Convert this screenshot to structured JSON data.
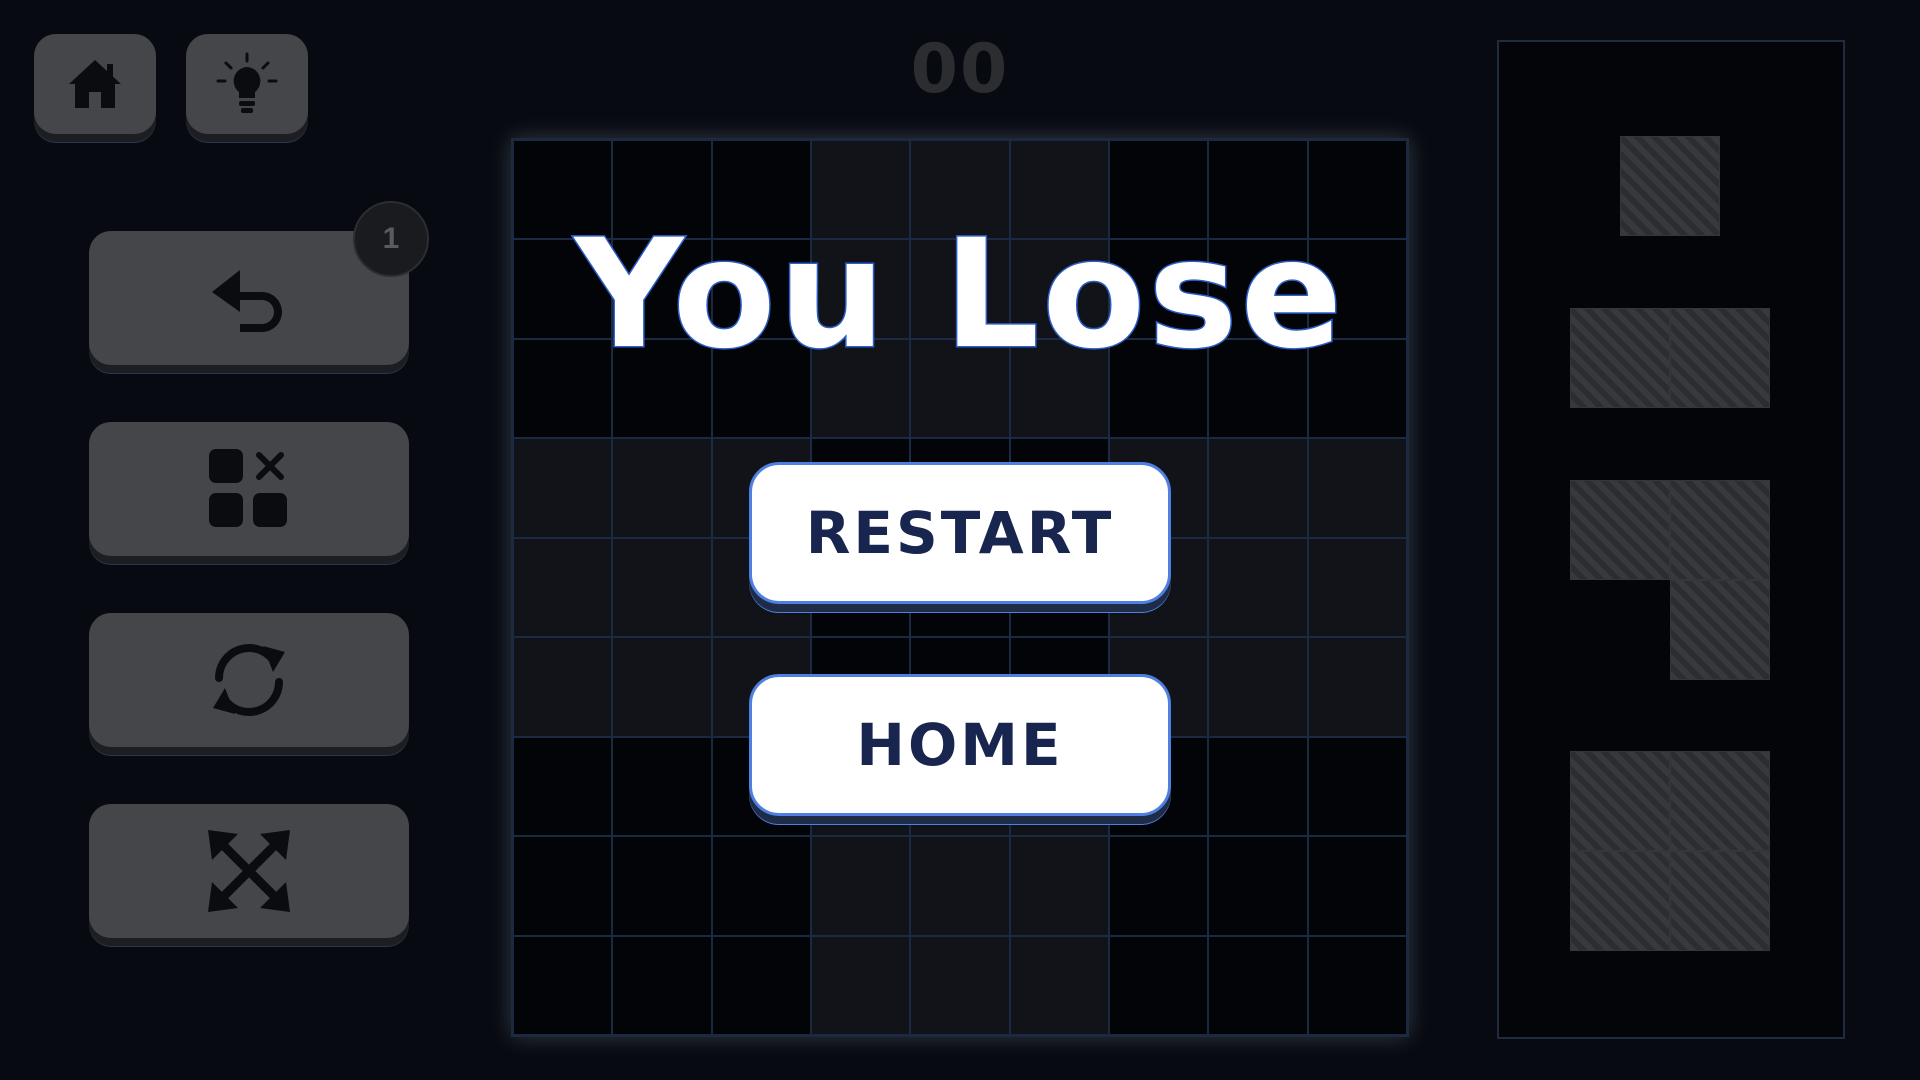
{
  "score": "00",
  "undo_badge": "1",
  "overlay": {
    "title": "You Lose",
    "restart_label": "RESTART",
    "home_label": "HOME"
  },
  "toolbar_icons": [
    "home-icon",
    "lightbulb-icon"
  ],
  "powerup_icons": [
    "undo-icon",
    "remove-block-icon",
    "rotate-icon",
    "expand-icon"
  ],
  "colors": {
    "background": "#070a10",
    "button": "#454649",
    "overlay_button": "#ffffff",
    "overlay_text": "#17254f",
    "accent": "#4f7fe0"
  },
  "board": {
    "rows": 9,
    "cols": 9
  },
  "pieces": [
    {
      "name": "single",
      "cells": [
        [
          0,
          0
        ]
      ]
    },
    {
      "name": "domino-horizontal",
      "cells": [
        [
          0,
          0
        ],
        [
          0,
          1
        ]
      ]
    },
    {
      "name": "l-tromino",
      "cells": [
        [
          0,
          0
        ],
        [
          0,
          1
        ],
        [
          1,
          1
        ]
      ]
    },
    {
      "name": "square-2x2",
      "cells": [
        [
          0,
          0
        ],
        [
          0,
          1
        ],
        [
          1,
          0
        ],
        [
          1,
          1
        ]
      ]
    }
  ]
}
